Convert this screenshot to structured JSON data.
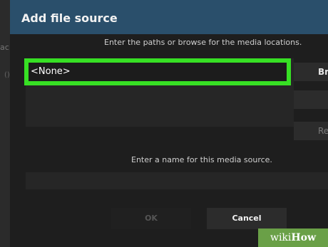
{
  "backdrop": {
    "frag1": "ac",
    "frag2": "()"
  },
  "dialog": {
    "title": "Add file source",
    "paths_hint": "Enter the paths or browse for the media locations.",
    "path_item": "<None>",
    "side_buttons": [
      "Br",
      "",
      "Re"
    ],
    "name_hint": "Enter a name for this media source.",
    "name_value": "",
    "ok_label": "OK",
    "cancel_label": "Cancel"
  },
  "watermark": {
    "wiki": "wiki",
    "how": "How"
  },
  "colors": {
    "highlight": "#37e024",
    "titlebar": "#2a4f6b",
    "watermark": "#6aa047"
  }
}
